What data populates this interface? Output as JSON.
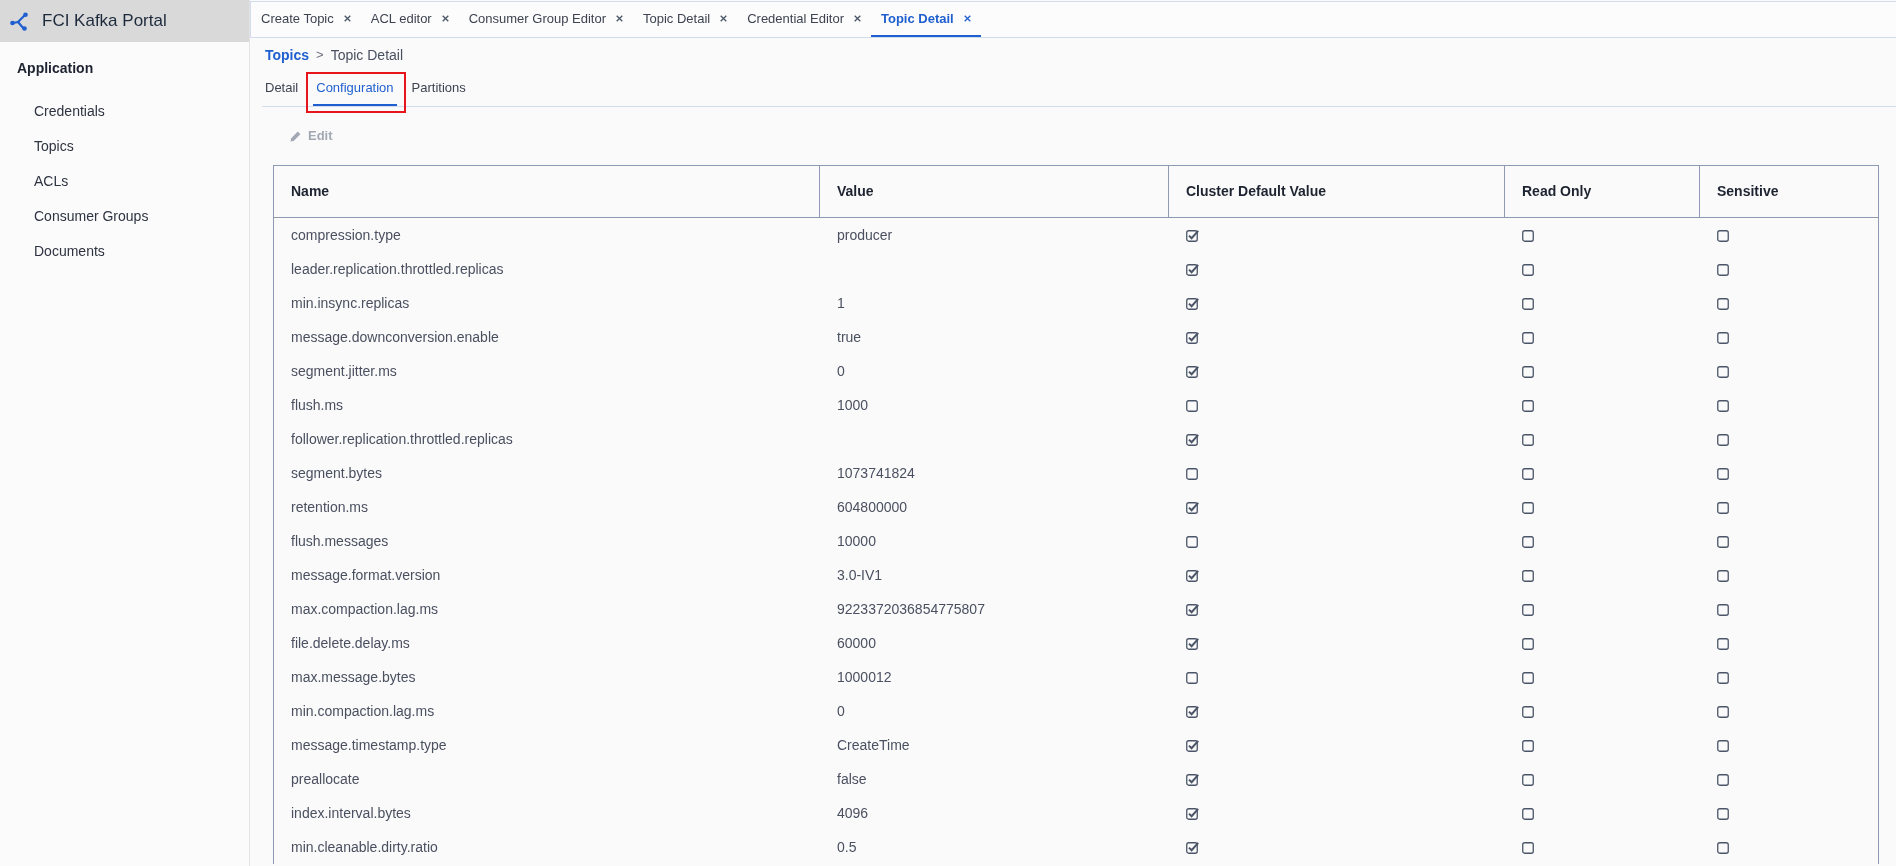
{
  "app": {
    "title": "FCI Kafka Portal"
  },
  "sidebar": {
    "section": "Application",
    "items": [
      {
        "label": "Credentials"
      },
      {
        "label": "Topics"
      },
      {
        "label": "ACLs"
      },
      {
        "label": "Consumer Groups"
      },
      {
        "label": "Documents"
      }
    ]
  },
  "tabs": [
    {
      "label": "Create Topic",
      "selected": false
    },
    {
      "label": "ACL editor",
      "selected": false
    },
    {
      "label": "Consumer Group Editor",
      "selected": false
    },
    {
      "label": "Topic Detail",
      "selected": false
    },
    {
      "label": "Credential Editor",
      "selected": false
    },
    {
      "label": "Topic Detail",
      "selected": true
    }
  ],
  "breadcrumb": {
    "separator": ">",
    "items": [
      {
        "label": "Topics",
        "kind": "link"
      },
      {
        "label": "Topic Detail",
        "kind": "current"
      }
    ]
  },
  "subtabs": [
    {
      "label": "Detail",
      "selected": false,
      "highlighted": false
    },
    {
      "label": "Configuration",
      "selected": true,
      "highlighted": true
    },
    {
      "label": "Partitions",
      "selected": false,
      "highlighted": false
    }
  ],
  "toolbar": {
    "edit": {
      "label": "Edit",
      "disabled": true
    }
  },
  "table": {
    "columns": [
      "Name",
      "Value",
      "Cluster Default Value",
      "Read Only",
      "Sensitive"
    ],
    "rows": [
      {
        "name": "compression.type",
        "value": "producer",
        "cluster_default": true,
        "read_only": false,
        "sensitive": false
      },
      {
        "name": "leader.replication.throttled.replicas",
        "cluster_default": true,
        "read_only": false,
        "sensitive": false
      },
      {
        "name": "min.insync.replicas",
        "value": "1",
        "cluster_default": true,
        "read_only": false,
        "sensitive": false
      },
      {
        "name": "message.downconversion.enable",
        "value": "true",
        "cluster_default": true,
        "read_only": false,
        "sensitive": false
      },
      {
        "name": "segment.jitter.ms",
        "value": "0",
        "cluster_default": true,
        "read_only": false,
        "sensitive": false
      },
      {
        "name": "flush.ms",
        "value": "1000",
        "cluster_default": false,
        "read_only": false,
        "sensitive": false
      },
      {
        "name": "follower.replication.throttled.replicas",
        "cluster_default": true,
        "read_only": false,
        "sensitive": false
      },
      {
        "name": "segment.bytes",
        "value": "1073741824",
        "cluster_default": false,
        "read_only": false,
        "sensitive": false
      },
      {
        "name": "retention.ms",
        "value": "604800000",
        "cluster_default": true,
        "read_only": false,
        "sensitive": false
      },
      {
        "name": "flush.messages",
        "value": "10000",
        "cluster_default": false,
        "read_only": false,
        "sensitive": false
      },
      {
        "name": "message.format.version",
        "value": "3.0-IV1",
        "cluster_default": true,
        "read_only": false,
        "sensitive": false
      },
      {
        "name": "max.compaction.lag.ms",
        "value": "9223372036854775807",
        "cluster_default": true,
        "read_only": false,
        "sensitive": false
      },
      {
        "name": "file.delete.delay.ms",
        "value": "60000",
        "cluster_default": true,
        "read_only": false,
        "sensitive": false
      },
      {
        "name": "max.message.bytes",
        "value": "1000012",
        "cluster_default": false,
        "read_only": false,
        "sensitive": false
      },
      {
        "name": "min.compaction.lag.ms",
        "value": "0",
        "cluster_default": true,
        "read_only": false,
        "sensitive": false
      },
      {
        "name": "message.timestamp.type",
        "value": "CreateTime",
        "cluster_default": true,
        "read_only": false,
        "sensitive": false
      },
      {
        "name": "preallocate",
        "value": "false",
        "cluster_default": true,
        "read_only": false,
        "sensitive": false
      },
      {
        "name": "index.interval.bytes",
        "value": "4096",
        "cluster_default": true,
        "read_only": false,
        "sensitive": false
      },
      {
        "name": "min.cleanable.dirty.ratio",
        "value": "0.5",
        "cluster_default": true,
        "read_only": false,
        "sensitive": false
      }
    ]
  }
}
